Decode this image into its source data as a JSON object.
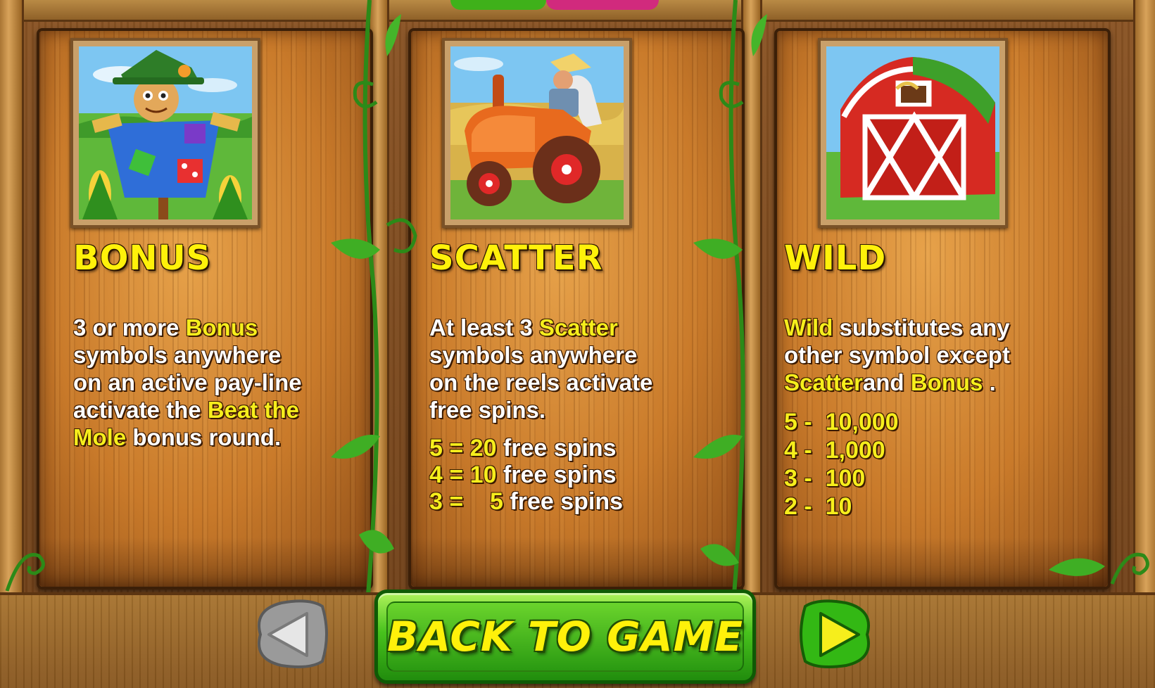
{
  "colors": {
    "title": "#fff10a",
    "highlight": "#f6ee1c",
    "body_text": "#ffffff",
    "button_green": "#48c21d",
    "wood": "#c97a2a"
  },
  "panels": {
    "bonus": {
      "title": "BONUS",
      "icon": "scarecrow-icon",
      "line1_a": "3 or more ",
      "line1_b": "Bonus",
      "line2": "symbols anywhere",
      "line3": "on an active pay-line",
      "line4_a": "activate the",
      "line4_b": "Beat the",
      "line5_a": "Mole",
      "line5_b": " bonus round."
    },
    "scatter": {
      "title": "SCATTER",
      "icon": "tractor-icon",
      "line1_a": "At least 3 ",
      "line1_b": "Scatter",
      "line2": "symbols anywhere",
      "line3": "on the reels activate",
      "line4": "free spins.",
      "payouts": [
        {
          "count": "5 =",
          "value": "20",
          "suffix": " free spins"
        },
        {
          "count": "4 =",
          "value": "10",
          "suffix": " free spins"
        },
        {
          "count": "3 =",
          "value": "5",
          "suffix": " free spins"
        }
      ]
    },
    "wild": {
      "title": "WILD",
      "icon": "barn-icon",
      "line1_a": "Wild",
      "line1_b": " substitutes any",
      "line2": "other symbol except",
      "line3_a": "Scatter",
      "line3_b": "and ",
      "line3_c": "Bonus",
      "line3_d": " .",
      "payouts": [
        {
          "count": "5",
          "sep": " -  ",
          "value": "10,000"
        },
        {
          "count": "4",
          "sep": " -  ",
          "value": "1,000"
        },
        {
          "count": "3",
          "sep": " -  ",
          "value": "100"
        },
        {
          "count": "2",
          "sep": " -  ",
          "value": "10"
        }
      ]
    }
  },
  "navigation": {
    "back_label": "BACK TO GAME",
    "prev_icon": "arrow-left-icon",
    "next_icon": "arrow-right-icon"
  }
}
